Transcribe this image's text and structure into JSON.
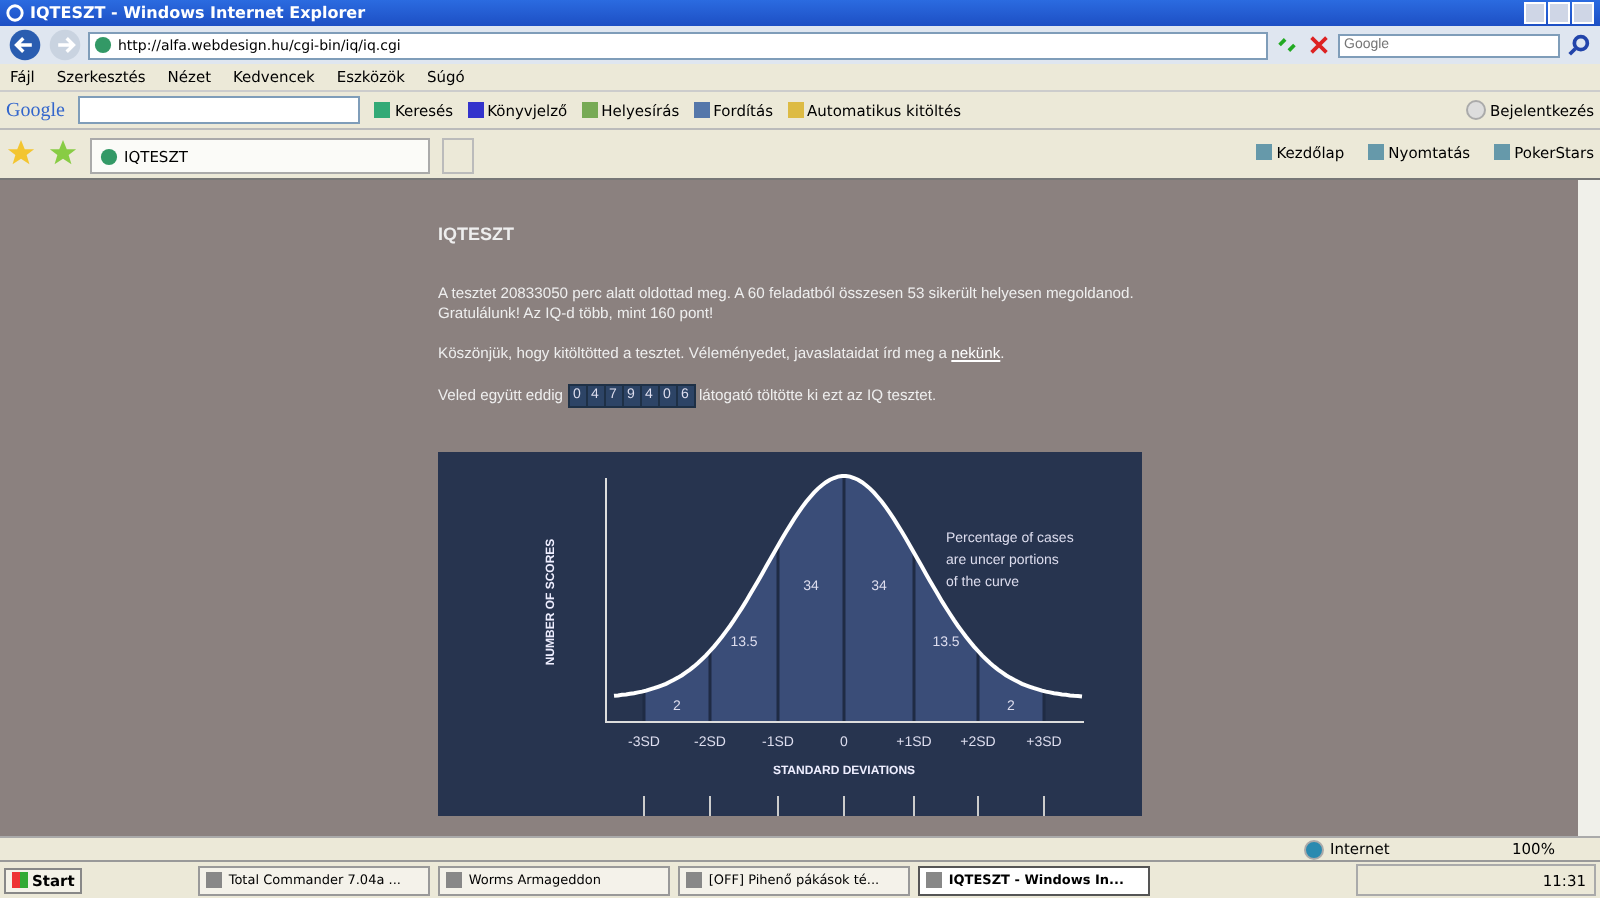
{
  "window": {
    "title": "IQTESZT - Windows Internet Explorer"
  },
  "address_bar": {
    "url": "http://alfa.webdesign.hu/cgi-bin/iq/iq.cgi",
    "search_placeholder": "Google"
  },
  "menu": [
    "Fájl",
    "Szerkesztés",
    "Nézet",
    "Kedvencek",
    "Eszközök",
    "Súgó"
  ],
  "google_toolbar": {
    "logo": "Google",
    "items": [
      {
        "kind": "search",
        "label": "Keresés"
      },
      {
        "kind": "star",
        "label": "Könyvjelző"
      },
      {
        "kind": "spell",
        "label": "Helyesírás"
      },
      {
        "kind": "translate",
        "label": "Fordítás"
      },
      {
        "kind": "autofill",
        "label": "Automatikus kitöltés"
      }
    ],
    "signin": "Bejelentkezés"
  },
  "tab": {
    "title": "IQTESZT",
    "selected": true
  },
  "command_bar": [
    "Kezdőlap",
    "Nyomtatás",
    "PokerStars"
  ],
  "page": {
    "heading": "IQTESZT",
    "result_lines": [
      "A tesztet 20833050 perc alatt oldottad meg. A 60 feladatból összesen 53 sikerült helyesen megoldanod.",
      "Gratulálunk! Az IQ-d több, mint 160 pont!"
    ],
    "thanks_text": "Köszönjük, hogy kitöltötted a tesztet. Véleményedet, javaslataidat írd meg a ",
    "thanks_link": "nekünk",
    "thanks_end": ".",
    "counter_before": "Veled együtt eddig",
    "counter_digits": [
      "0",
      "4",
      "7",
      "9",
      "4",
      "0",
      "6"
    ],
    "counter_after": "látogató töltötte ki ezt az IQ tesztet.",
    "figure": {
      "y_label": "NUMBER OF SCORES",
      "x_label": "STANDARD DEVIATIONS",
      "note": [
        "Percentage of cases",
        "are uncer portions",
        "of the curve"
      ],
      "percents": [
        "2",
        "13.5",
        "34",
        "34",
        "13.5",
        "2"
      ],
      "ticks": [
        "-3SD",
        "-2SD",
        "-1SD",
        "0",
        "+1SD",
        "+2SD",
        "+3SD"
      ]
    }
  },
  "status_bar": {
    "zone": "Internet",
    "zoom": "100%"
  },
  "taskbar": {
    "start": "Start",
    "tasks": [
      {
        "label": "Total Commander 7.04a ...",
        "selected": false
      },
      {
        "label": "Worms Armageddon",
        "selected": false
      },
      {
        "label": "[OFF] Pihenő pákások té...",
        "selected": false
      },
      {
        "label": "IQTESZT - Windows In...",
        "selected": true
      }
    ],
    "clock": "11:31"
  }
}
